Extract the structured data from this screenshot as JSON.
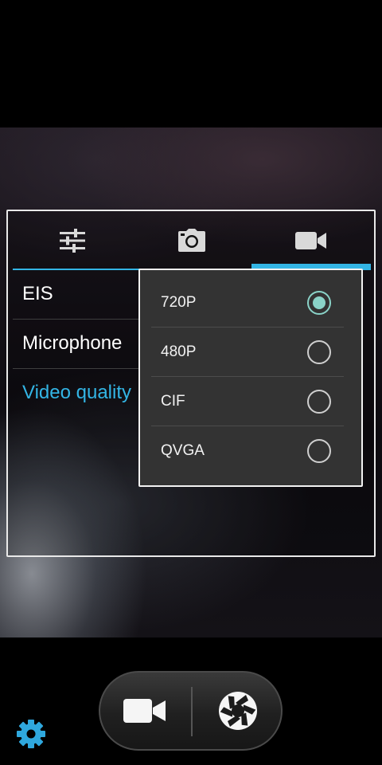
{
  "tabs": [
    {
      "name": "general-settings",
      "icon": "sliders-icon",
      "active": false
    },
    {
      "name": "photo-settings",
      "icon": "camera-icon",
      "active": false
    },
    {
      "name": "video-settings",
      "icon": "video-camera-icon",
      "active": true
    }
  ],
  "preferences": [
    {
      "label": "EIS",
      "active": false
    },
    {
      "label": "Microphone",
      "active": false
    },
    {
      "label": "Video quality",
      "active": true
    }
  ],
  "video_quality_dialog": {
    "options": [
      {
        "label": "720P",
        "selected": true
      },
      {
        "label": "480P",
        "selected": false
      },
      {
        "label": "CIF",
        "selected": false
      },
      {
        "label": "QVGA",
        "selected": false
      }
    ]
  },
  "controls": {
    "video_button_icon": "video-camera-icon",
    "shutter_button_icon": "shutter-icon",
    "settings_icon": "gear-icon"
  },
  "colors": {
    "accent": "#33b5e5",
    "radio_selected": "#8ad3c8",
    "dialog_bg": "#333333"
  }
}
